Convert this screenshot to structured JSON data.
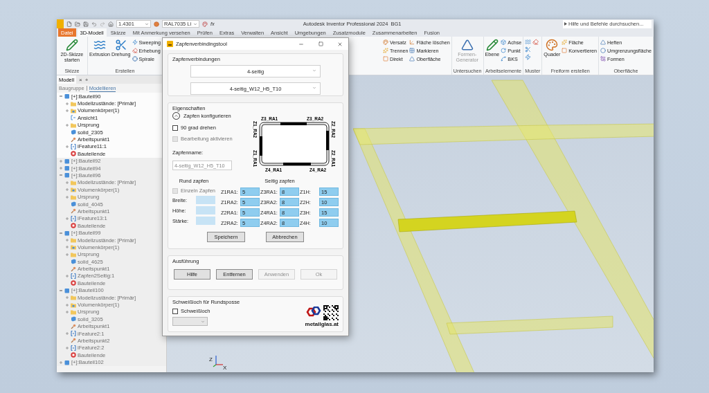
{
  "quick_access": {
    "material": "1.4301",
    "appearance": "RAL7035 Li",
    "fx": "fx"
  },
  "app_title": "Autodesk Inventor Professional 2024",
  "document": "BG1",
  "search": {
    "placeholder": "Hilfe und Befehle durchsuchen..."
  },
  "tabs": [
    {
      "label": "Datei",
      "kind": "file",
      "selected": false
    },
    {
      "label": "3D-Modell",
      "kind": "tab",
      "selected": true
    },
    {
      "label": "Skizze",
      "kind": "tab",
      "selected": false
    },
    {
      "label": "Mit Anmerkung versehen",
      "kind": "tab",
      "selected": false
    },
    {
      "label": "Prüfen",
      "kind": "tab",
      "selected": false
    },
    {
      "label": "Extras",
      "kind": "tab",
      "selected": false
    },
    {
      "label": "Verwalten",
      "kind": "tab",
      "selected": false
    },
    {
      "label": "Ansicht",
      "kind": "tab",
      "selected": false
    },
    {
      "label": "Umgebungen",
      "kind": "tab",
      "selected": false
    },
    {
      "label": "Zusatzmodule",
      "kind": "tab",
      "selected": false
    },
    {
      "label": "Zusammenarbeiten",
      "kind": "tab",
      "selected": false
    },
    {
      "label": "Fusion",
      "kind": "tab",
      "selected": false
    }
  ],
  "ribbon": {
    "left_groups": [
      {
        "label": "Skizze",
        "tools": [
          {
            "label": "2D-Skizze starten",
            "kind": "large"
          }
        ]
      },
      {
        "label": "Erstellen",
        "tools": [
          {
            "label": "Extrusion",
            "kind": "large"
          },
          {
            "label": "Drehung",
            "kind": "large"
          },
          {
            "label": "Sweeping",
            "kind": "small"
          },
          {
            "label": "Erhebung",
            "kind": "small"
          },
          {
            "label": "Spirale",
            "kind": "small"
          }
        ]
      }
    ],
    "right_groups": [
      {
        "tools": [
          {
            "label": "Versatz",
            "kind": "small"
          },
          {
            "label": "Trennen",
            "kind": "small"
          },
          {
            "label": "Direkt",
            "kind": "small"
          },
          {
            "label": "Fläche löschen",
            "kind": "small"
          },
          {
            "label": "Markieren",
            "kind": "small"
          },
          {
            "label": "Oberfläche",
            "kind": "small"
          }
        ]
      },
      {
        "label": "Untersuchen",
        "tools": [
          {
            "label": "Formen-Generator",
            "kind": "large",
            "disabled": true
          }
        ]
      },
      {
        "label": "Arbeitselemente",
        "tools": [
          {
            "label": "Ebene",
            "kind": "large"
          },
          {
            "label": "Achse",
            "kind": "small"
          },
          {
            "label": "Punkt",
            "kind": "small"
          },
          {
            "label": "BKS",
            "kind": "small"
          }
        ]
      },
      {
        "label": "Muster",
        "tools": [
          {
            "kind": "icon"
          },
          {
            "kind": "icon"
          },
          {
            "kind": "icon"
          },
          {
            "kind": "icon"
          }
        ]
      },
      {
        "label": "Freiform erstellen",
        "tools": [
          {
            "label": "Quader",
            "kind": "large"
          },
          {
            "label": "Fläche",
            "kind": "small"
          },
          {
            "label": "Konvertieren",
            "kind": "small"
          }
        ]
      },
      {
        "label": "Oberfläche",
        "tools": [
          {
            "label": "Heften",
            "kind": "small"
          },
          {
            "label": "Umgrenzungsfläche",
            "kind": "small"
          },
          {
            "label": "Formen",
            "kind": "small"
          }
        ]
      }
    ]
  },
  "browser": {
    "tabs": [
      {
        "label": "Modell",
        "selected": true
      }
    ],
    "close": "×",
    "add": "+",
    "modes": [
      {
        "label": "Baugruppe",
        "selected": false
      },
      {
        "label": "Modellieren",
        "selected": true
      }
    ],
    "tree": [
      {
        "kind": "part",
        "label": "[+]:Bauteil90",
        "expanded": true,
        "active": true,
        "children": [
          {
            "kind": "folder",
            "label": "Modellzustände: [Primär]",
            "expanded": false
          },
          {
            "kind": "bodies",
            "label": "Volumenkörper(1)",
            "expanded": false
          },
          {
            "kind": "view",
            "label": "Ansicht1"
          },
          {
            "kind": "folder",
            "label": "Ursprung",
            "expanded": false
          },
          {
            "kind": "solid",
            "label": "solid_2305"
          },
          {
            "kind": "point",
            "label": "Arbeitspunkt1"
          },
          {
            "kind": "feature",
            "label": "iFeature11:1",
            "expanded": false
          },
          {
            "kind": "end",
            "label": "Bauteilende"
          }
        ]
      },
      {
        "kind": "part",
        "label": "[+]:Bauteil92",
        "expanded": false,
        "active": false
      },
      {
        "kind": "part",
        "label": "[+]:Bauteil94",
        "expanded": false,
        "active": false
      },
      {
        "kind": "part",
        "label": "[+]:Bauteil96",
        "expanded": true,
        "active": false,
        "children": [
          {
            "kind": "folder",
            "label": "Modellzustände: [Primär]",
            "expanded": false
          },
          {
            "kind": "bodies",
            "label": "Volumenkörper(1)",
            "expanded": false
          },
          {
            "kind": "folder",
            "label": "Ursprung",
            "expanded": false
          },
          {
            "kind": "solid",
            "label": "solid_4045"
          },
          {
            "kind": "point",
            "label": "Arbeitspunkt1"
          },
          {
            "kind": "feature",
            "label": "iFeature13:1",
            "expanded": false
          },
          {
            "kind": "end",
            "label": "Bauteilende"
          }
        ]
      },
      {
        "kind": "part",
        "label": "[+]:Bauteil99",
        "expanded": true,
        "active": false,
        "children": [
          {
            "kind": "folder",
            "label": "Modellzustände: [Primär]",
            "expanded": false
          },
          {
            "kind": "bodies",
            "label": "Volumenkörper(1)",
            "expanded": false
          },
          {
            "kind": "folder",
            "label": "Ursprung",
            "expanded": false
          },
          {
            "kind": "solid",
            "label": "solid_4625"
          },
          {
            "kind": "point",
            "label": "Arbeitspunkt1"
          },
          {
            "kind": "feature",
            "label": "Zapfen2Seitig:1",
            "expanded": false
          },
          {
            "kind": "end",
            "label": "Bauteilende"
          }
        ]
      },
      {
        "kind": "part",
        "label": "[+]:Bauteil100",
        "expanded": true,
        "active": false,
        "children": [
          {
            "kind": "folder",
            "label": "Modellzustände: [Primär]",
            "expanded": false
          },
          {
            "kind": "bodies",
            "label": "Volumenkörper(1)",
            "expanded": false
          },
          {
            "kind": "folder",
            "label": "Ursprung",
            "expanded": false
          },
          {
            "kind": "solid",
            "label": "solid_3205"
          },
          {
            "kind": "point",
            "label": "Arbeitspunkt1"
          },
          {
            "kind": "feature",
            "label": "iFeature2:1",
            "expanded": false
          },
          {
            "kind": "point",
            "label": "Arbeitspunkt2"
          },
          {
            "kind": "feature",
            "label": "iFeature2:2",
            "expanded": false
          },
          {
            "kind": "end",
            "label": "Bauteilende"
          }
        ]
      },
      {
        "kind": "part",
        "label": "[+]:Bauteil102",
        "expanded": false,
        "active": false
      }
    ]
  },
  "viewport": {
    "axis_labels": [
      "Z",
      "X"
    ]
  },
  "dialog": {
    "title": "Zapfenverbindingstool",
    "connections": {
      "title": "Zapfenverbindungen",
      "dropdowns": [
        "4-seitig",
        "4-seitig_W12_H5_T10"
      ]
    },
    "properties": {
      "title": "Eigenschaften",
      "configure": {
        "label": "Zapfen konfigurieren",
        "expanded": true
      },
      "checkboxes": [
        {
          "label": "90 grad drehen",
          "checked": false,
          "disabled": false
        },
        {
          "label": "Bearbeitung aktivieren",
          "checked": false,
          "disabled": true
        }
      ],
      "name_label": "Zapfenname:",
      "name_value": "4-seitig_W12_H5_T10",
      "diagram_labels": {
        "top": [
          "Z3_RA1",
          "Z3_RA2"
        ],
        "left": [
          "Z1_RA2",
          "Z1_RA1"
        ],
        "right": [
          "Z2_RA2",
          "Z2_RA1"
        ],
        "bottom": [
          "Z4_RA1",
          "Z4_RA2"
        ]
      },
      "round": {
        "title": "Rund zapfen",
        "checkbox": {
          "label": "Einzeln Zapfen",
          "checked": false,
          "disabled": true
        },
        "fields": [
          "Breite:",
          "Höhe:",
          "Stärke:"
        ]
      },
      "side": {
        "title": "Seitig zapfen",
        "fields": [
          {
            "label": "Z1RA1:",
            "value": "5"
          },
          {
            "label": "Z3RA1:",
            "value": "8"
          },
          {
            "label": "Z1H:",
            "value": "15"
          },
          {
            "label": "Z1RA2:",
            "value": "5"
          },
          {
            "label": "Z3RA2:",
            "value": "8"
          },
          {
            "label": "Z2H:",
            "value": "10"
          },
          {
            "label": "Z2RA1:",
            "value": "5"
          },
          {
            "label": "Z4RA1:",
            "value": "8"
          },
          {
            "label": "Z3H:",
            "value": "15"
          },
          {
            "label": "Z2RA2:",
            "value": "5"
          },
          {
            "label": "Z4RA2:",
            "value": "8"
          },
          {
            "label": "Z4H:",
            "value": "10"
          }
        ]
      },
      "buttons": [
        {
          "label": "Speichern",
          "disabled": false
        },
        {
          "label": "Abbrechen",
          "disabled": false
        }
      ]
    },
    "execution": {
      "title": "Ausführung",
      "buttons": [
        {
          "label": "Hilfe",
          "disabled": false
        },
        {
          "label": "Entfernen",
          "disabled": false
        },
        {
          "label": "Anwenden",
          "disabled": true
        },
        {
          "label": "Ok",
          "disabled": true
        }
      ]
    },
    "weld": {
      "title": "Schweißloch für Rundsposse",
      "checkbox": {
        "label": "Schweißloch",
        "checked": false,
        "disabled": false
      },
      "logo_text": "metallglas.at"
    }
  }
}
